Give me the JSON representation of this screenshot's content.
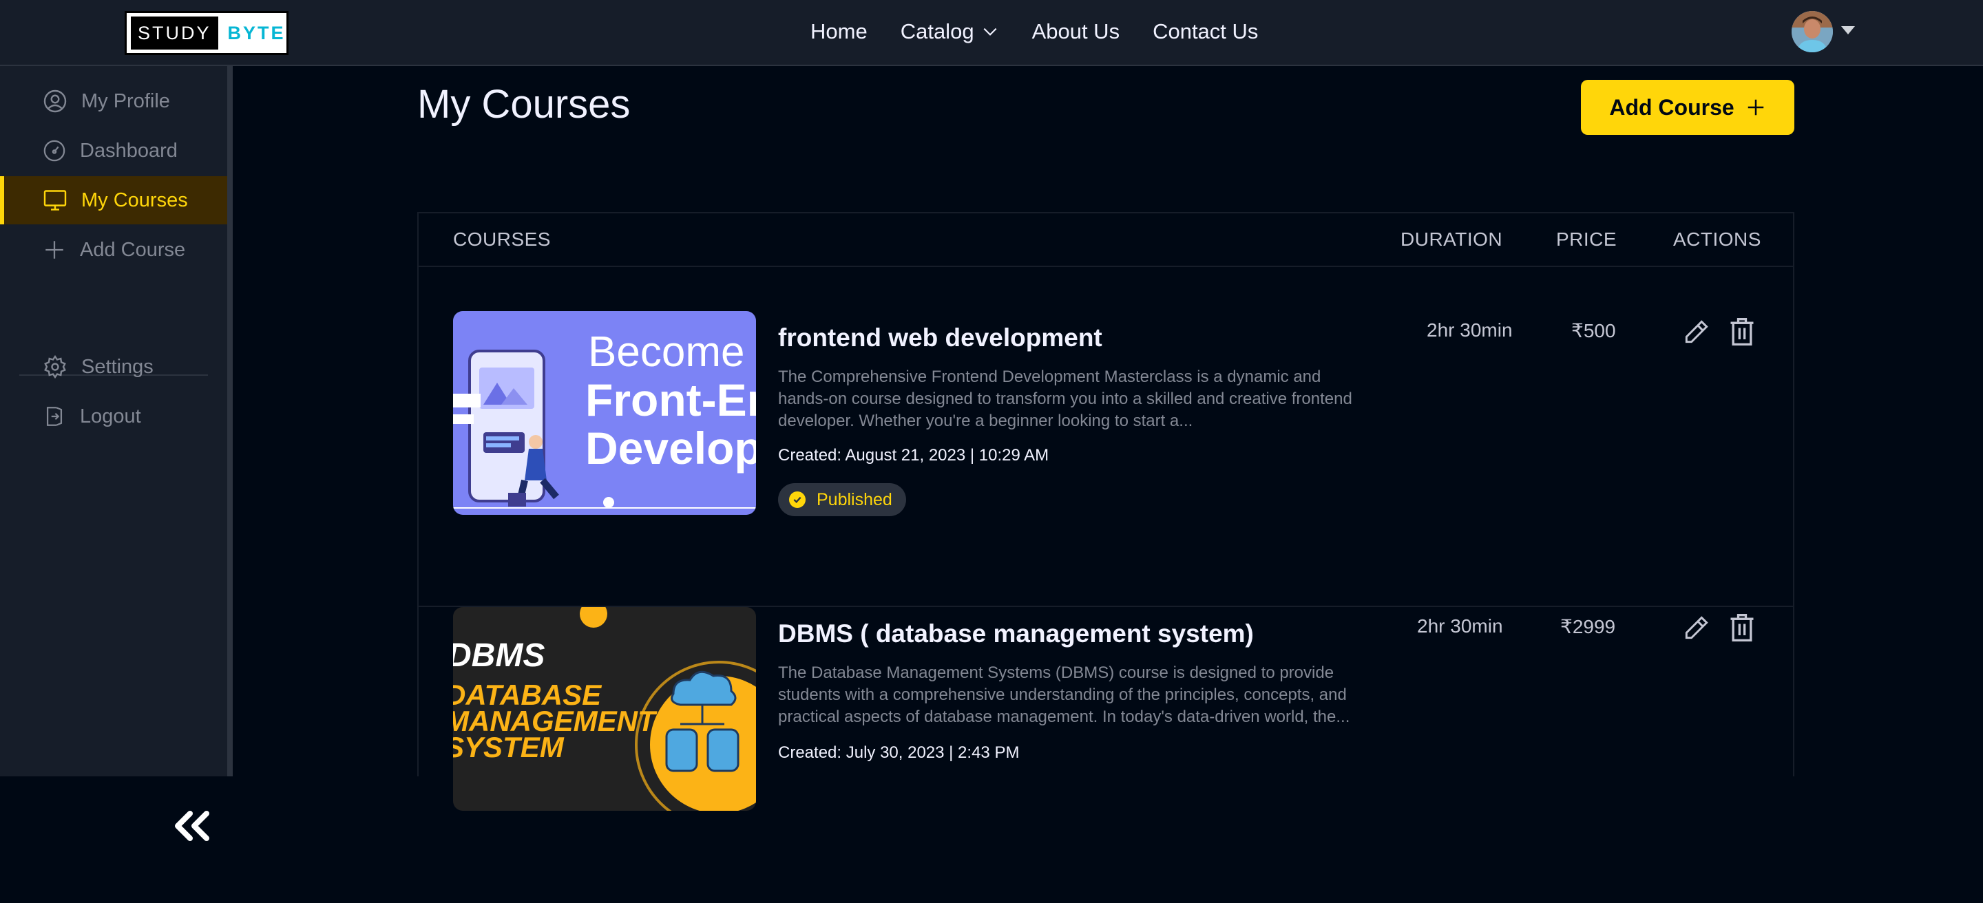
{
  "brand": {
    "part1": "STUDY",
    "part2": "BYTE"
  },
  "nav": {
    "home": "Home",
    "catalog": "Catalog",
    "about": "About Us",
    "contact": "Contact Us"
  },
  "sidebar": {
    "items": [
      {
        "label": "My Profile",
        "icon": "user-circle-icon"
      },
      {
        "label": "Dashboard",
        "icon": "gauge-icon"
      },
      {
        "label": "My Courses",
        "icon": "monitor-icon",
        "active": true
      },
      {
        "label": "Add Course",
        "icon": "plus-icon"
      }
    ],
    "bottom": [
      {
        "label": "Settings",
        "icon": "gear-icon"
      },
      {
        "label": "Logout",
        "icon": "logout-icon"
      }
    ]
  },
  "main": {
    "title": "My Courses",
    "add_button": "Add Course",
    "table": {
      "headers": {
        "courses": "COURSES",
        "duration": "DURATION",
        "price": "PRICE",
        "actions": "ACTIONS"
      },
      "rows": [
        {
          "title": "frontend web development",
          "description": "The Comprehensive Frontend Development Masterclass is a dynamic and hands-on course designed to transform you into a skilled and creative frontend developer. Whether you're a beginner looking to start a...",
          "created": "Created: August 21, 2023 | 10:29 AM",
          "status": "Published",
          "duration": "2hr 30min",
          "price": "₹500",
          "thumb_text": [
            "Become",
            "Front-End",
            "Develop"
          ]
        },
        {
          "title": "DBMS ( database management system)",
          "description": "The Database Management Systems (DBMS) course is designed to provide students with a comprehensive understanding of the principles, concepts, and practical aspects of database management. In today's data-driven world, the...",
          "created": "Created: July 30, 2023 | 2:43 PM",
          "status": "",
          "duration": "2hr 30min",
          "price": "₹2999",
          "thumb_text": [
            "DBMS",
            "DATABASE",
            "MANAGEMENT",
            "SYSTEM"
          ]
        }
      ]
    }
  },
  "colors": {
    "accent": "#ffd60a",
    "bg": "#000814",
    "panel": "#161d29",
    "muted": "#838894"
  }
}
